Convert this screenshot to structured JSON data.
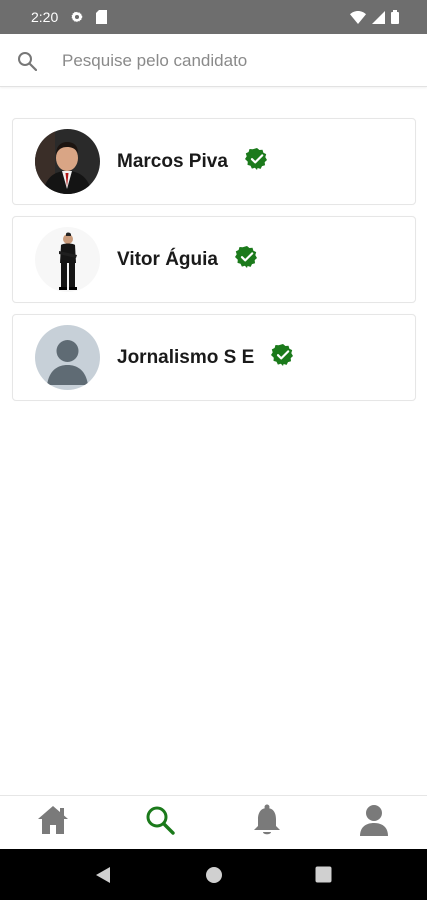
{
  "status_bar": {
    "time": "2:20",
    "icons": [
      "settings-gear-icon",
      "sd-card-icon",
      "wifi-icon",
      "signal-icon",
      "battery-icon"
    ]
  },
  "search": {
    "placeholder": "Pesquise pelo candidato",
    "value": ""
  },
  "candidates": [
    {
      "name": "Marcos Piva",
      "verified": true,
      "avatar": "photo-man-suit"
    },
    {
      "name": "Vitor Águia",
      "verified": true,
      "avatar": "photo-man-standing"
    },
    {
      "name": "Jornalismo S E",
      "verified": true,
      "avatar": "default-user-placeholder"
    }
  ],
  "bottom_nav": {
    "items": [
      {
        "icon": "home-icon",
        "active": false
      },
      {
        "icon": "search-icon",
        "active": true
      },
      {
        "icon": "bell-icon",
        "active": false
      },
      {
        "icon": "profile-icon",
        "active": false
      }
    ],
    "active_color": "#1b7a1b",
    "inactive_color": "#7a7a7a"
  },
  "colors": {
    "verified_badge": "#1b7a1b",
    "status_bar": "#6e6e6e"
  }
}
